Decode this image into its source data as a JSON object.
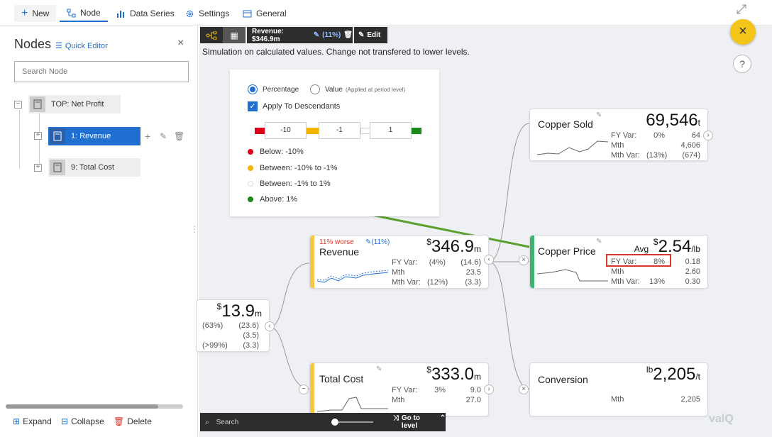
{
  "tabs": {
    "new": "New",
    "node": "Node",
    "data_series": "Data Series",
    "settings": "Settings",
    "general": "General"
  },
  "left": {
    "title": "Nodes",
    "quick_editor": "Quick Editor",
    "search_placeholder": "Search Node",
    "tree": [
      {
        "label": "TOP: Net Profit"
      },
      {
        "label": "1: Revenue"
      },
      {
        "label": "9: Total Cost"
      }
    ],
    "footer": {
      "expand": "Expand",
      "collapse": "Collapse",
      "delete": "Delete"
    }
  },
  "toolbar": {
    "revenue_chip": "Revenue: $346.9m",
    "revenue_pct": "(11%)",
    "edit": "Edit"
  },
  "notice": "Simulation on calculated values. Change not transfered to lower levels.",
  "sim": {
    "percentage": "Percentage",
    "value": "Value",
    "value_note": "(Applied at period level)",
    "apply": "Apply To Descendants",
    "thresholds": [
      "-10",
      "-1",
      "1"
    ],
    "legend": [
      {
        "label": "Below: -10%",
        "color": "#e0001b"
      },
      {
        "label": "Between: -10% to -1%",
        "color": "#f4b400"
      },
      {
        "label": "Between: -1% to 1%",
        "color": "#ffffff"
      },
      {
        "label": "Above: 1%",
        "color": "#1a8a1a"
      }
    ]
  },
  "cards": {
    "copper_sold": {
      "title": "Copper Sold",
      "value": "69,546",
      "unit": "t",
      "rows": [
        [
          "FY Var:",
          "0%",
          "64"
        ],
        [
          "Mth",
          "",
          "4,606"
        ],
        [
          "Mth Var:",
          "(13%)",
          "(674)"
        ]
      ]
    },
    "revenue": {
      "flag": "11% worse",
      "sim": "(11%)",
      "title": "Revenue",
      "cur": "$",
      "value": "346.9",
      "unit": "m",
      "rows": [
        [
          "FY Var:",
          "(4%)",
          "(14.6)"
        ],
        [
          "Mth",
          "",
          "23.5"
        ],
        [
          "Mth Var:",
          "(12%)",
          "(3.3)"
        ]
      ]
    },
    "copper_price": {
      "title": "Copper Price",
      "avg": "Avg",
      "cur": "$",
      "value": "2.54",
      "unit": "/lb",
      "rows": [
        [
          "FY Var:",
          "8%",
          "0.18"
        ],
        [
          "Mth",
          "",
          "2.60"
        ],
        [
          "Mth Var:",
          "13%",
          "0.30"
        ]
      ]
    },
    "net_profit": {
      "cur": "$",
      "value": "13.9",
      "unit": "m",
      "rows": [
        [
          "(63%)",
          "(23.6)"
        ],
        [
          "",
          "(3.5)"
        ],
        [
          "(>99%)",
          "(3.3)"
        ]
      ]
    },
    "total_cost": {
      "title": "Total Cost",
      "cur": "$",
      "value": "333.0",
      "unit": "m",
      "rows": [
        [
          "FY Var:",
          "3%",
          "9.0"
        ],
        [
          "Mth",
          "",
          "27.0"
        ]
      ]
    },
    "conversion": {
      "title": "Conversion",
      "cur": "lb",
      "value": "2,205",
      "unit": "/t",
      "rows": [
        [
          "Mth",
          "",
          "2,205"
        ]
      ]
    }
  },
  "bottom": {
    "search": "Search",
    "go_to_level": "Go to level"
  },
  "brand": "valQ",
  "colors": {
    "accent": "#1f6fd1",
    "card_bar_yellow": "#f6c744",
    "card_bar_green": "#3cb371",
    "close_btn": "#f4c518",
    "highlight": "#d9352b"
  }
}
